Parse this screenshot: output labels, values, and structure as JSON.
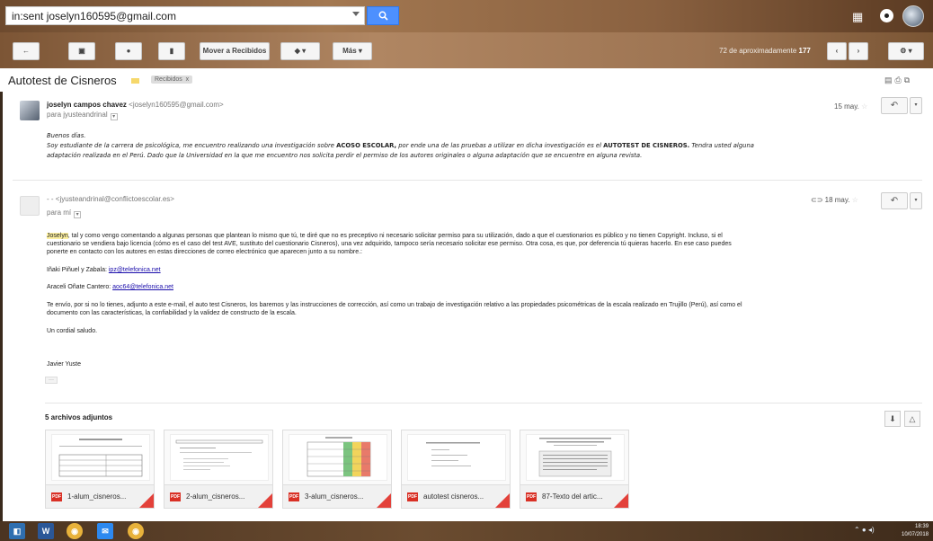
{
  "search": {
    "value": "in:sent joselyn160595@gmail.com",
    "button_icon": "search-icon"
  },
  "toolbar": {
    "move_label": "Mover a Recibidos",
    "more_label": "Más",
    "count_prefix": "72 de aproximadamente",
    "count_total": "177"
  },
  "thread": {
    "subject": "Autotest de Cisneros",
    "label": "Recibidos",
    "label_close": "x"
  },
  "msg1": {
    "sender_name": "joselyn campos chavez",
    "sender_addr": "<joselyn160595@gmail.com>",
    "to": "para jyusteandrinal",
    "date": "15 may.",
    "greeting": "Buenos días.",
    "body_a": "Soy estudiante de la carrera de psicológica, me encuentro realizando una investigación sobre ",
    "body_b": "ACOSO ESCOLAR,",
    "body_c": " por ende una de las pruebas a utilizar en dicha investigación es el ",
    "body_d": "AUTOTEST DE CISNEROS.",
    "body_e": " Tendra usted alguna",
    "body_line2": "adaptación realizada en el Perú. Dado que la Universidad en la que me encuentro nos solicita perdir el permiso de los autores originales o alguna adaptación que se encuentre en alguna revista."
  },
  "msg2": {
    "sender_addr": "- - <jyusteandrinal@conflictoescolar.es>",
    "to": "para mí",
    "date": "18 may.",
    "p1_name": "Joselyn",
    "p1_line1": ", tal y como vengo comentando a algunas personas que plantean lo mismo que tú, te diré que no es preceptivo ni necesario solicitar permiso para su utilización, dado a que el cuestionarios es público y no tienen Copyright. Incluso, si el",
    "p1_line2": "cuestionario se vendiera bajo licencia (cómo es el caso del test AVE, sustituto del cuestionario Cisneros), una vez adquirido, tampoco sería necesario solicitar ese permiso. Otra cosa, es que, por deferencia tú quieras hacerlo. En ese caso puedes",
    "p1_line3": "ponerte en contacto con los autores en estas direcciones de correo electrónico que aparecen junto a  su nombre.:",
    "author1_name": "Iñaki Piñuel y Zabala: ",
    "author1_email": "ipz@telefonica.net",
    "author2_name": "Araceli Oñate Cantero: ",
    "author2_email": "aoc64@telefonica.net",
    "p2_line1": "Te envío, por si no lo tienes, adjunto a este e-mail,  el auto test Cisneros, los baremos y las instrucciones de corrección,  así como un trabajo de investigación  relativo a las propiedades psicométricas de la escala realizado en Trujillo (Perú), así como el",
    "p2_line2": "documento  con las características, la confiabilidad y la validez de constructo de la escala.",
    "closing": "Un cordial saludo.",
    "signature": "Javier Yuste",
    "ellipsis": "···"
  },
  "attachments": {
    "title": "5 archivos adjuntos",
    "files": [
      {
        "name": "1-alum_cisneros...",
        "type": "PDF"
      },
      {
        "name": "2-alum_cisneros...",
        "type": "PDF"
      },
      {
        "name": "3-alum_cisneros...",
        "type": "PDF"
      },
      {
        "name": "autotest cisneros...",
        "type": "PDF"
      },
      {
        "name": "87-Texto del artic...",
        "type": "PDF"
      }
    ]
  },
  "taskbar": {
    "time": "18:39",
    "date": "10/07/2018"
  },
  "colors": {
    "accent": "#4d90fe",
    "pdf": "#d93025",
    "link": "#1a0dab"
  }
}
